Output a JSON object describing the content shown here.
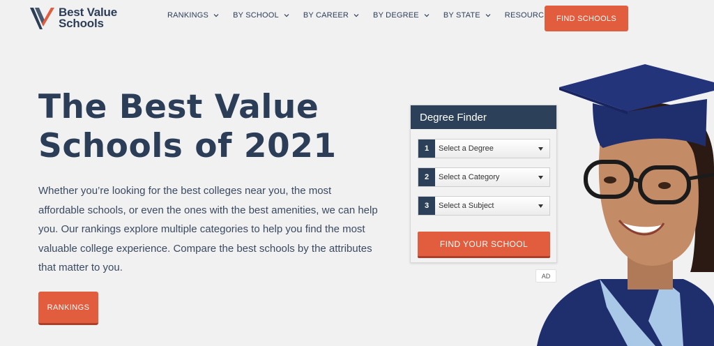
{
  "brand": {
    "line1": "Best Value",
    "line2": "Schools",
    "color": "#2c3e57",
    "accent": "#e25d3d"
  },
  "nav": {
    "items": [
      {
        "label": "RANKINGS"
      },
      {
        "label": "BY SCHOOL"
      },
      {
        "label": "BY CAREER"
      },
      {
        "label": "BY DEGREE"
      },
      {
        "label": "BY STATE"
      },
      {
        "label": "RESOURCES"
      }
    ],
    "search_icon": "search-icon",
    "cta_label": "FIND SCHOOLS"
  },
  "hero": {
    "title_line1": "The Best Value",
    "title_line2": "Schools of 2021",
    "description": "Whether you’re looking for the best colleges near you, the most affordable schools, or even the ones with the best amenities, we can help you. Our rankings explore multiple categories to help you find the most valuable college experience. Compare the best schools by the attributes that matter to you.",
    "button_label": "RANKINGS"
  },
  "finder": {
    "title": "Degree Finder",
    "rows": [
      {
        "number": "1",
        "placeholder": "Select a Degree"
      },
      {
        "number": "2",
        "placeholder": "Select a Category"
      },
      {
        "number": "3",
        "placeholder": "Select a Subject"
      }
    ],
    "button_label": "FIND YOUR SCHOOL",
    "ad_label": "AD"
  }
}
